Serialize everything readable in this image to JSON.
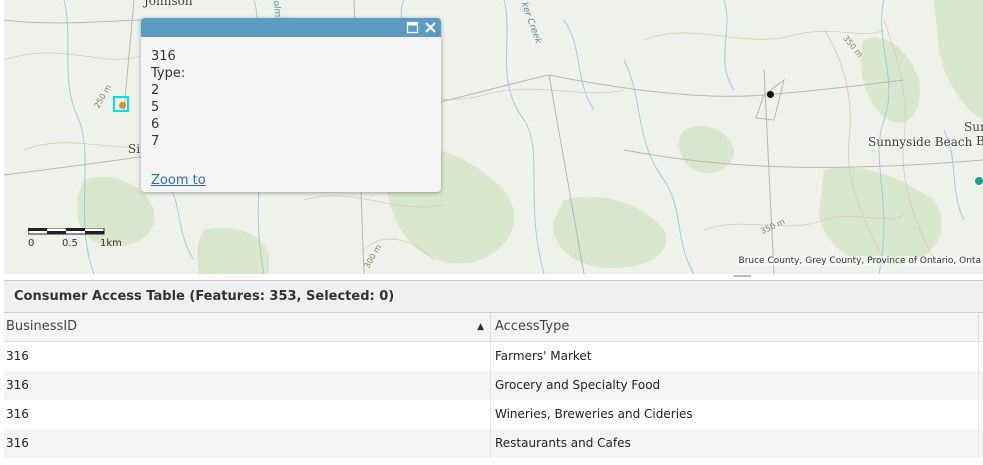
{
  "map": {
    "place_labels": {
      "johnson": "Johnson",
      "si": "Si",
      "sunnyside": "Sunnyside Beach",
      "sun_partial": "Sun",
      "b_partial": "B"
    },
    "contour_labels": {
      "c250": "250 m",
      "c350a": "350 m",
      "c350b": "350 m",
      "c300": "300 m"
    },
    "creek_label": "ker Creek",
    "creek_label2": "olm",
    "scale": {
      "labels": [
        "0",
        "0.5",
        "1km"
      ]
    },
    "attribution": "Bruce County, Grey County, Province of Ontario, Onta",
    "markers": [
      {
        "name": "selected-marker",
        "color": "#e58a25",
        "highlight": "#00e0f0"
      },
      {
        "name": "black-marker",
        "color": "#111111"
      },
      {
        "name": "teal-marker",
        "color": "#1aa08a"
      }
    ]
  },
  "popup": {
    "business_id": "316",
    "type_label": "Type:",
    "types": [
      "2",
      "5",
      "6",
      "7"
    ],
    "zoom_link": "Zoom to",
    "maximize_icon": "maximize-icon",
    "close_icon": "close-icon",
    "header_color": "#5b9bc4"
  },
  "table": {
    "title": "Consumer Access Table (Features: 353, Selected: 0)",
    "columns": [
      "BusinessID",
      "AccessType"
    ],
    "sort_icon": "sort-ascending-icon",
    "rows": [
      {
        "business_id": "316",
        "access_type": "Farmers' Market"
      },
      {
        "business_id": "316",
        "access_type": "Grocery and Specialty Food"
      },
      {
        "business_id": "316",
        "access_type": "Wineries, Breweries and Cideries"
      },
      {
        "business_id": "316",
        "access_type": "Restaurants and Cafes"
      }
    ]
  }
}
